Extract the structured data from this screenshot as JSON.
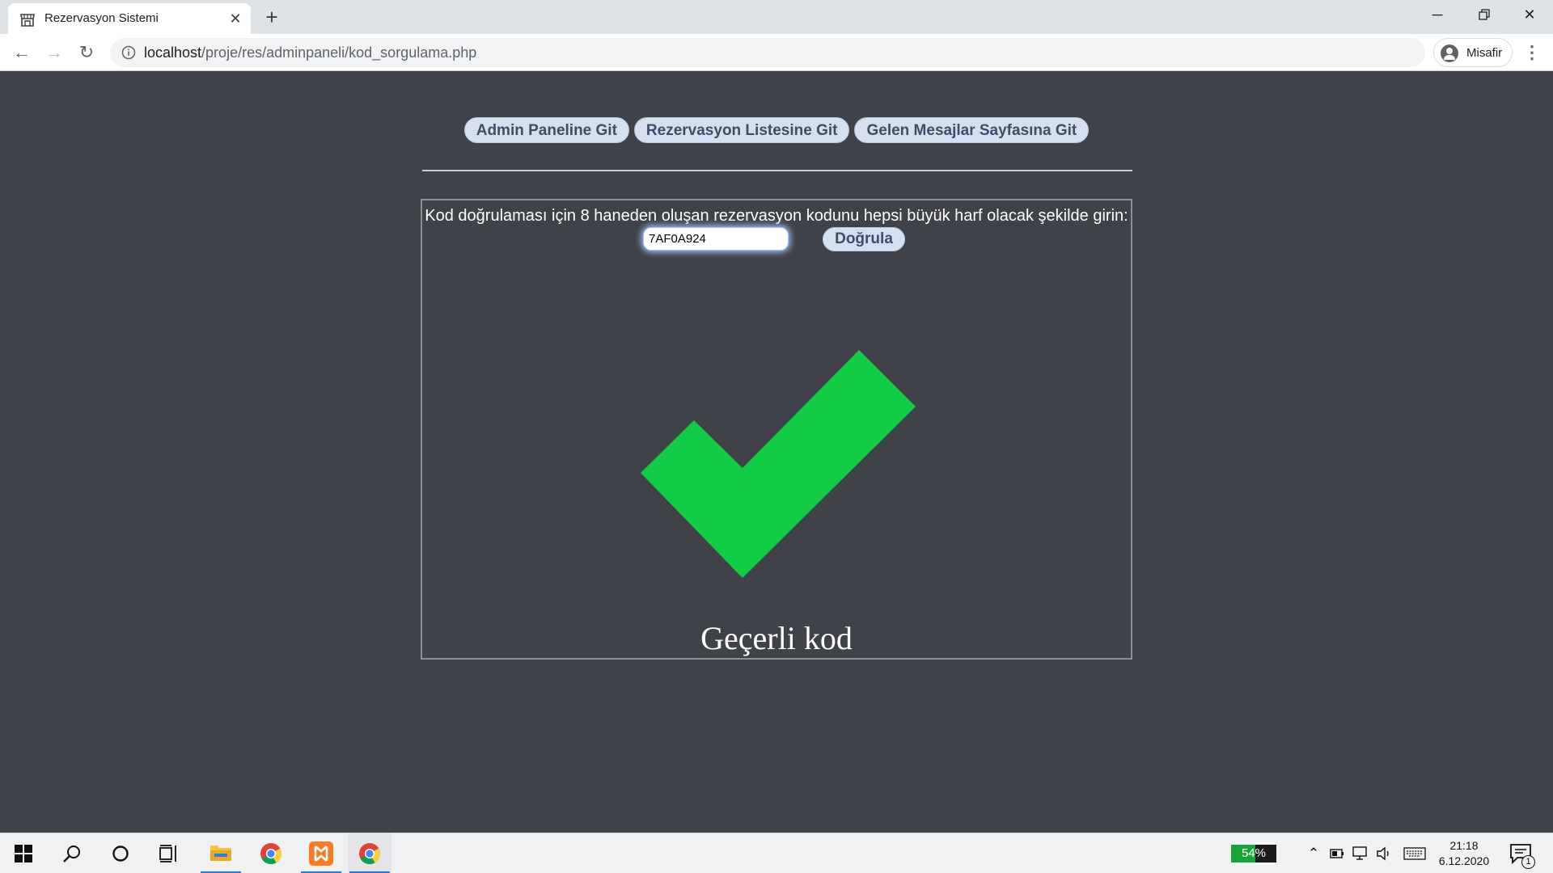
{
  "browser": {
    "tab_title": "Rezervasyon Sistemi",
    "url_host": "localhost",
    "url_path": "/proje/res/adminpaneli/kod_sorgulama.php",
    "profile_label": "Misafir"
  },
  "nav": {
    "admin_panel": "Admin Paneline Git",
    "reservation_list": "Rezervasyon Listesine Git",
    "messages": "Gelen Mesajlar Sayfasına Git"
  },
  "verify": {
    "instruction": "Kod doğrulaması için 8 haneden oluşan rezervasyon kodunu hepsi büyük harf olacak şekilde girin:",
    "code_value": "7AF0A924",
    "button_label": "Doğrula",
    "result_text": "Geçerli kod",
    "result_icon": "checkmark-icon",
    "result_color": "#11cc44"
  },
  "taskbar": {
    "battery_percent": "54%",
    "battery_level": 0.54,
    "time": "21:18",
    "date": "6.12.2020",
    "notification_count": "1",
    "apps": [
      "start",
      "search",
      "cortana",
      "task-view",
      "file-explorer",
      "chrome",
      "xampp",
      "chrome"
    ]
  }
}
